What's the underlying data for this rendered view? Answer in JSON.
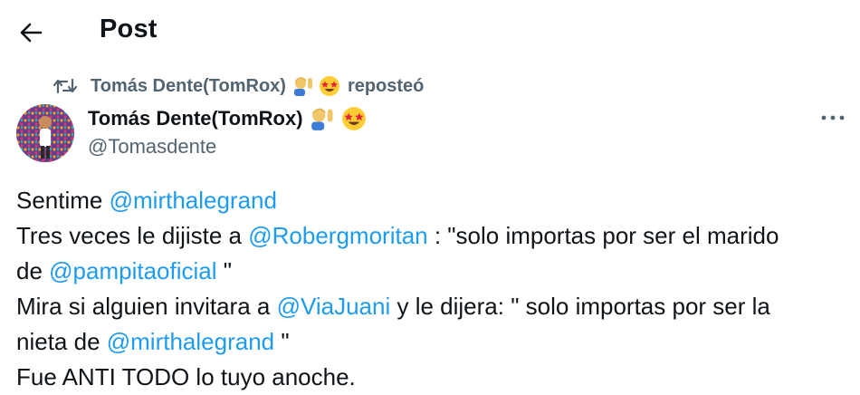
{
  "header": {
    "back_icon": "arrow-left-icon",
    "title": "Post"
  },
  "repost": {
    "icon": "repost-icon",
    "reposter_name": "Tomás Dente(TomRox)",
    "emojis": [
      "man-raising-hand-emoji",
      "star-struck-emoji"
    ],
    "action_text": "reposteó"
  },
  "author": {
    "name": "Tomás Dente(TomRox)",
    "emojis": [
      "man-raising-hand-emoji",
      "star-struck-emoji"
    ],
    "handle": "@Tomasdente",
    "more_icon": "more-horizontal-icon"
  },
  "tweet": {
    "line1": {
      "text": "Sentime ",
      "mention": "@mirthalegrand"
    },
    "line2": {
      "text": "Tres veces le dijiste a ",
      "mention": "@Robergmoritan",
      "after": " : \"solo importas por ser el marido"
    },
    "line3": {
      "text": "de ",
      "mention": "@pampitaoficial",
      "after": " \""
    },
    "line4": {
      "text": "Mira si alguien invitara a ",
      "mention": "@ViaJuani",
      "after": " y le dijera: \" solo importas por ser la"
    },
    "line5": {
      "text": "nieta de ",
      "mention": "@mirthalegrand",
      "after": " \""
    },
    "line6": {
      "text": "Fue ANTI TODO lo tuyo anoche."
    }
  },
  "colors": {
    "text": "#0f1419",
    "secondary": "#536471",
    "link": "#1d9bf0",
    "background": "#ffffff"
  }
}
